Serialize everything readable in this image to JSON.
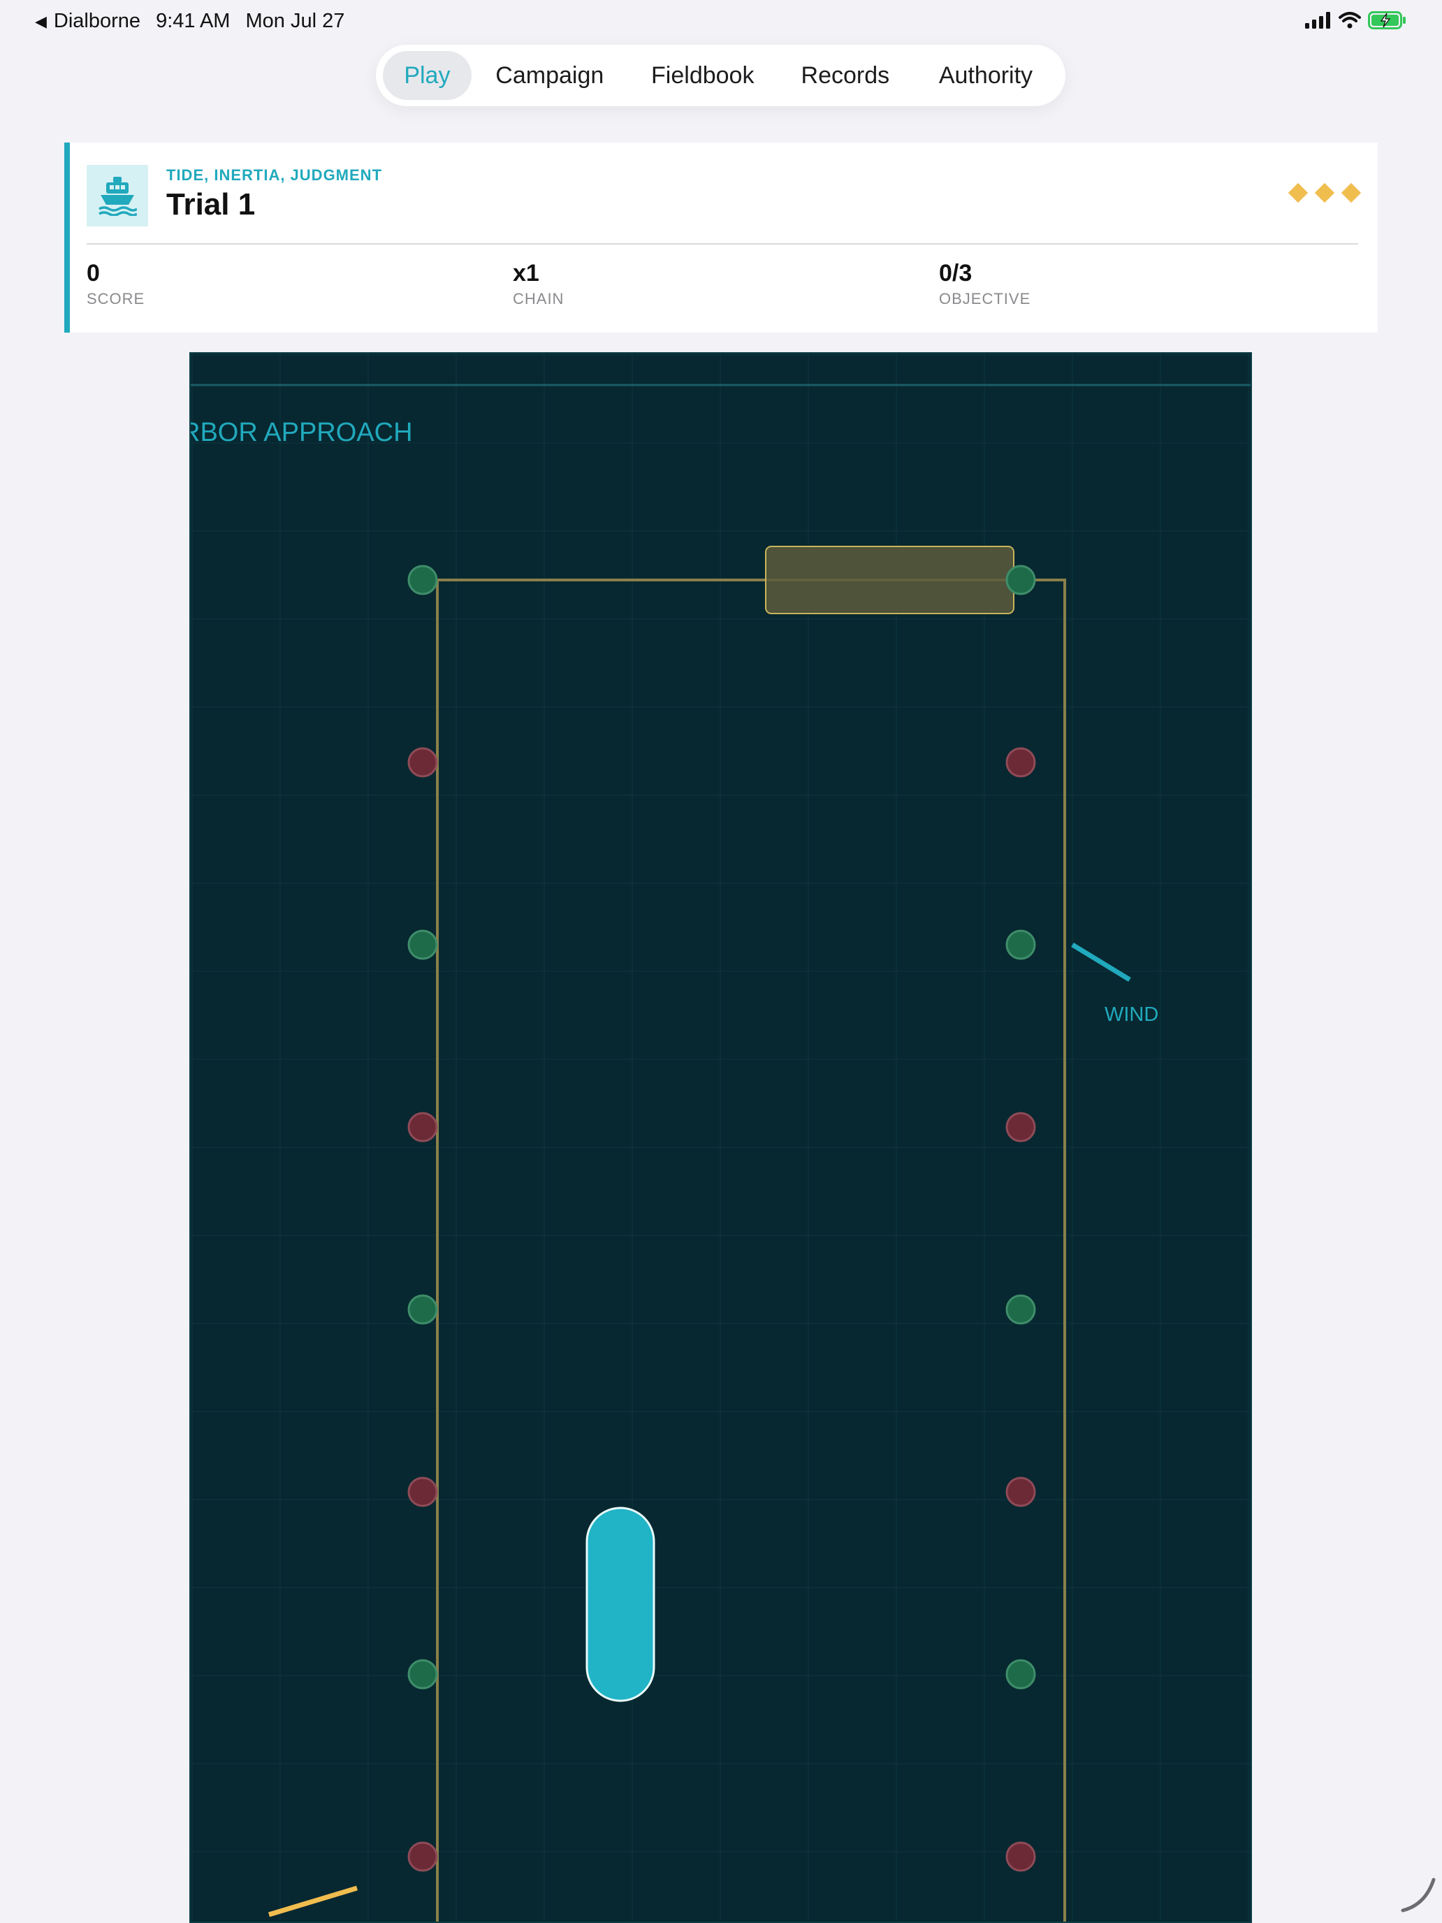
{
  "status_bar": {
    "back_app": "Dialborne",
    "time": "9:41 AM",
    "date": "Mon Jul 27"
  },
  "tabs": [
    {
      "label": "Play",
      "active": true
    },
    {
      "label": "Campaign",
      "active": false
    },
    {
      "label": "Fieldbook",
      "active": false
    },
    {
      "label": "Records",
      "active": false
    },
    {
      "label": "Authority",
      "active": false
    }
  ],
  "hud": {
    "icon": "ship-icon",
    "eyebrow": "TIDE, INERTIA, JUDGMENT",
    "title": "Trial 1",
    "gems": 3,
    "stats": {
      "score": {
        "value": "0",
        "label": "SCORE"
      },
      "chain": {
        "value": "x1",
        "label": "CHAIN"
      },
      "objective": {
        "value": "0/3",
        "label": "OBJECTIVE"
      }
    }
  },
  "game": {
    "zone_label": "RBOR APPROACH",
    "wind_label": "WIND",
    "colors": {
      "water": "#072830",
      "grid": "#13404a",
      "channel_border": "#8a7f4a",
      "buoy_green": "#1e6b4a",
      "buoy_red": "#6b2a36",
      "boat": "#21b3c6",
      "dock": "#5a5a3c",
      "wind": "#21a9bd",
      "current": "#f0bd4f"
    },
    "buoy_rows": [
      "green",
      "red",
      "green",
      "red",
      "green",
      "red",
      "green",
      "red"
    ]
  }
}
